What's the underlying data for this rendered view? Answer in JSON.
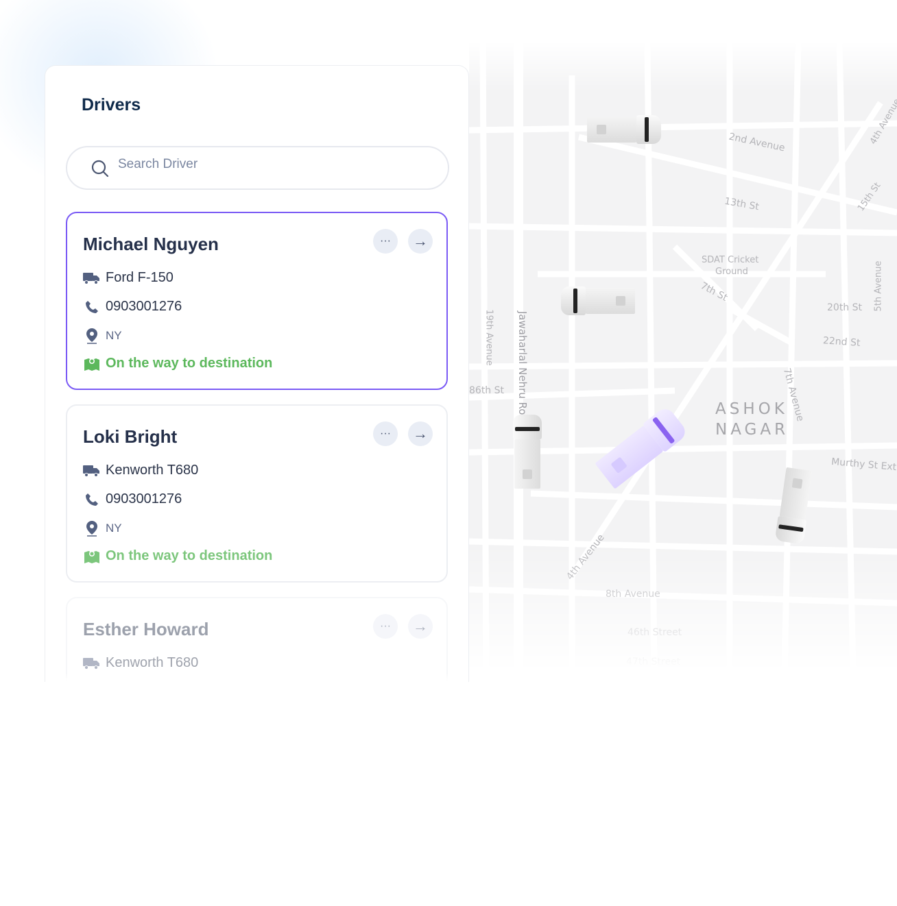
{
  "panel": {
    "title": "Drivers",
    "search": {
      "placeholder": "Search Driver",
      "value": ""
    }
  },
  "drivers": [
    {
      "name": "Michael Nguyen",
      "vehicle": "Ford F-150",
      "phone": "0903001276",
      "location": "NY",
      "status": "On the way to destination",
      "selected": true
    },
    {
      "name": "Loki Bright",
      "vehicle": "Kenworth T680",
      "phone": "0903001276",
      "location": "NY",
      "status": "On the way to destination",
      "selected": false
    },
    {
      "name": "Esther Howard",
      "vehicle": "Kenworth T680",
      "selected": false
    }
  ],
  "map": {
    "labels": [
      "2nd Avenue",
      "13th St",
      "SDAT Cricket",
      "Ground",
      "7th St",
      "20th St",
      "22nd St",
      "5th Avenue",
      "4th Avenue",
      "15th St",
      "7th Avenue",
      "Murthy St Ext",
      "4th Avenue",
      "8th Avenue",
      "46th Street",
      "47th Street",
      "19th Avenue",
      "Jawaharlal Nehru Road",
      "86th St"
    ],
    "area": [
      "ASHOK",
      "NAGAR"
    ]
  },
  "colors": {
    "accent": "#7a5af5",
    "status": "#5cb85c",
    "title": "#0f2a4a"
  }
}
